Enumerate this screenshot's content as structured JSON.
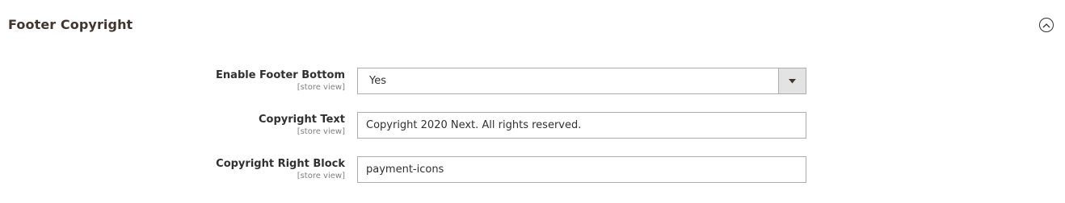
{
  "section": {
    "title": "Footer Copyright",
    "toggle_icon": "chevron-up-circle-icon"
  },
  "fields": {
    "enable_footer_bottom": {
      "label": "Enable Footer Bottom",
      "scope": "[store view]",
      "value": "Yes",
      "icon": "dropdown-arrow-icon"
    },
    "copyright_text": {
      "label": "Copyright Text",
      "scope": "[store view]",
      "value": "Copyright 2020 Next. All rights reserved."
    },
    "copyright_right_block": {
      "label": "Copyright Right Block",
      "scope": "[store view]",
      "value": "payment-icons"
    }
  },
  "colors": {
    "title": "#41362f",
    "text": "#303030",
    "scope": "#808080",
    "border": "#adadad",
    "select_button_bg": "#e3e3e3"
  }
}
